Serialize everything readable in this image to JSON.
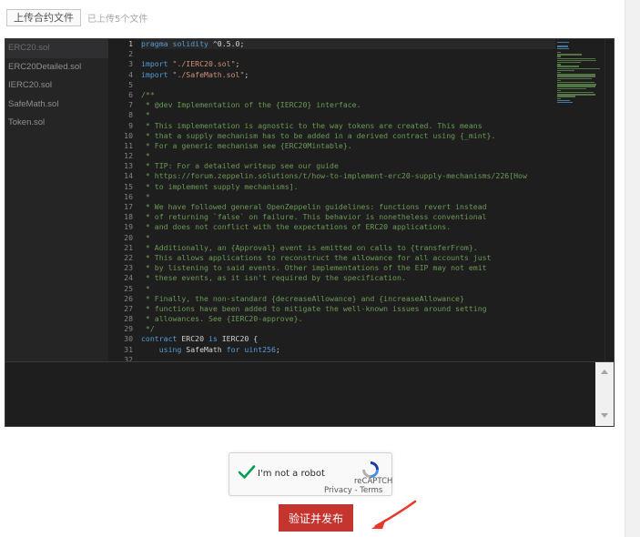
{
  "upload": {
    "button_label": "上传合约文件",
    "status_text": "已上传5个文件"
  },
  "files": [
    "ERC20.sol",
    "ERC20Detailed.sol",
    "IERC20.sol",
    "SafeMath.sol",
    "Token.sol"
  ],
  "editor": {
    "active_file": "ERC20.sol",
    "line_numbers": [
      "1",
      "2",
      "3",
      "4",
      "5",
      "6",
      "7",
      "8",
      "9",
      "10",
      "11",
      "12",
      "13",
      "14",
      "15",
      "16",
      "17",
      "18",
      "19",
      "20",
      "21",
      "22",
      "23",
      "24",
      "25",
      "26",
      "27",
      "28",
      "29",
      "30",
      "31",
      "32"
    ],
    "lines": [
      "pragma solidity ^0.5.0;",
      "",
      "import \"./IERC20.sol\";",
      "import \"./SafeMath.sol\";",
      "",
      "/**",
      " * @dev Implementation of the {IERC20} interface.",
      " *",
      " * This implementation is agnostic to the way tokens are created. This means",
      " * that a supply mechanism has to be added in a derived contract using {_mint}.",
      " * For a generic mechanism see {ERC20Mintable}.",
      " *",
      " * TIP: For a detailed writeup see our guide",
      " * https://forum.zeppelin.solutions/t/how-to-implement-erc20-supply-mechanisms/226[How",
      " * to implement supply mechanisms].",
      " *",
      " * We have followed general OpenZeppelin guidelines: functions revert instead",
      " * of returning `false` on failure. This behavior is nonetheless conventional",
      " * and does not conflict with the expectations of ERC20 applications.",
      " *",
      " * Additionally, an {Approval} event is emitted on calls to {transferFrom}.",
      " * This allows applications to reconstruct the allowance for all accounts just",
      " * by listening to said events. Other implementations of the EIP may not emit",
      " * these events, as it isn't required by the specification.",
      " *",
      " * Finally, the non-standard {decreaseAllowance} and {increaseAllowance}",
      " * functions have been added to mitigate the well-known issues around setting",
      " * allowances. See {IERC20-approve}.",
      " */",
      "contract ERC20 is IERC20 {",
      "    using SafeMath for uint256;",
      ""
    ]
  },
  "recaptcha": {
    "label": "I'm not a robot",
    "brand": "reCAPTCH",
    "privacy": "Privacy",
    "separator": " - ",
    "terms": "Terms"
  },
  "submit": {
    "label": "验证并发布"
  },
  "colors": {
    "submit_bg": "#c43530",
    "annotation_arrow": "#e8382c",
    "check_green": "#009e55"
  }
}
